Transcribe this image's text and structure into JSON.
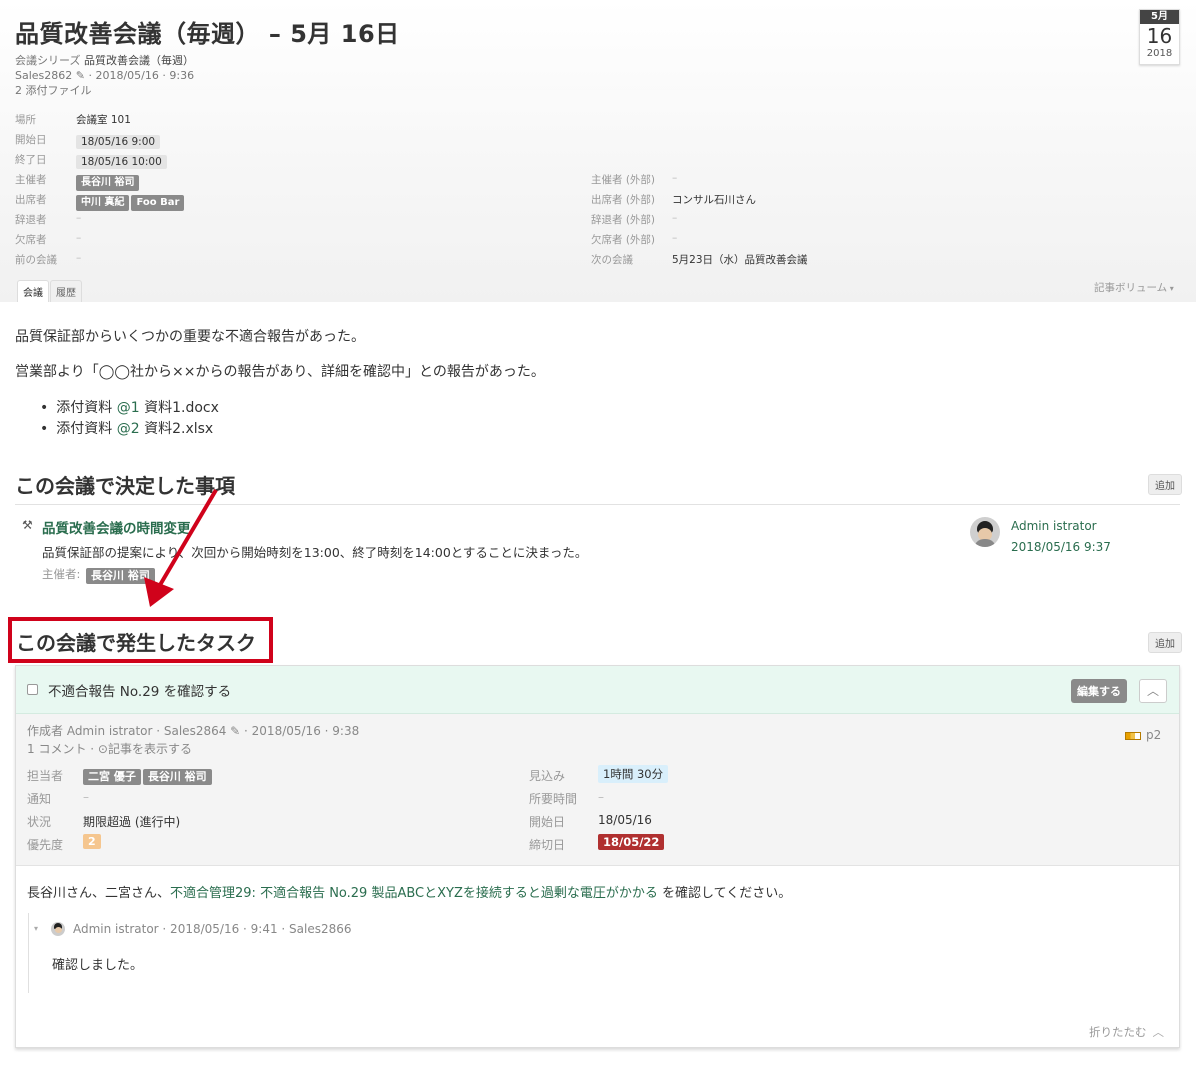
{
  "header": {
    "title": "品質改善会議（毎週） – 5月 16日",
    "series_label": "会議シリーズ",
    "series_name": "品質改善会議（毎週）",
    "record_info": "Sales2862 ✎ · 2018/05/16 · 9:36",
    "attachments": "2 添付ファイル",
    "calendar": {
      "month": "5月",
      "day": "16",
      "year": "2018"
    }
  },
  "fields_left": {
    "location_label": "場所",
    "location_value": "会議室 101",
    "start_label": "開始日",
    "start_value": "18/05/16 9:00",
    "end_label": "終了日",
    "end_value": "18/05/16 10:00",
    "organizer_label": "主催者",
    "organizer_value": "長谷川 裕司",
    "attendees_label": "出席者",
    "attendees": [
      "中川 真紀",
      "Foo Bar"
    ],
    "declined_label": "辞退者",
    "declined_value": "–",
    "absent_label": "欠席者",
    "absent_value": "–",
    "prev_label": "前の会議",
    "prev_value": "–"
  },
  "fields_right": {
    "ext_organizer_label": "主催者 (外部)",
    "ext_organizer_value": "–",
    "ext_attendees_label": "出席者 (外部)",
    "ext_attendees_value": "コンサル石川さん",
    "ext_declined_label": "辞退者 (外部)",
    "ext_declined_value": "–",
    "ext_absent_label": "欠席者 (外部)",
    "ext_absent_value": "–",
    "next_label": "次の会議",
    "next_value": "5月23日（水）品質改善会議"
  },
  "tabs": {
    "meeting": "会議",
    "history": "履歴",
    "volume": "記事ボリューム"
  },
  "content": {
    "para1": "品質保証部からいくつかの重要な不適合報告があった。",
    "para2": "営業部より「◯◯社から××からの報告があり、詳細を確認中」との報告があった。",
    "bullets": [
      {
        "prefix": "添付資料 ",
        "ref": "@1",
        "file": " 資料1.docx"
      },
      {
        "prefix": "添付資料 ",
        "ref": "@2",
        "file": " 資料2.xlsx"
      }
    ]
  },
  "decisions": {
    "heading": "この会議で決定した事項",
    "add": "追加",
    "item_title": "品質改善会議の時間変更",
    "item_body": "品質保証部の提案により、次回から開始時刻を13:00、終了時刻を14:00とすることに決まった。",
    "organizer_label": "主催者:",
    "organizer_tag": "長谷川 裕司",
    "author": "Admin istrator",
    "author_time": "2018/05/16 9:37"
  },
  "tasks": {
    "heading": "この会議で発生したタスク",
    "add": "追加",
    "task_title": "不適合報告 No.29 を確認する",
    "edit": "編集する",
    "creator_line": "作成者 Admin istrator · Sales2864 ✎ · 2018/05/16 · 9:38",
    "comments_line": "1 コメント · ⊙記事を表示する",
    "priority_code": "p2",
    "assignee_label": "担当者",
    "assignees": [
      "二宮 優子",
      "長谷川 裕司"
    ],
    "notify_label": "通知",
    "notify_value": "–",
    "status_label": "状況",
    "status_value": "期限超過 (進行中)",
    "priority_label": "優先度",
    "priority_value": "2",
    "estimate_label": "見込み",
    "estimate_value": "1時間 30分",
    "spent_label": "所要時間",
    "spent_value": "–",
    "start_label": "開始日",
    "start_value": "18/05/16",
    "due_label": "締切日",
    "due_value": "18/05/22",
    "body_prefix": "長谷川さん、二宮さん、",
    "body_link": "不適合管理29: 不適合報告 No.29 製品ABCとXYZを接続すると過剰な電圧がかかる",
    "body_suffix": " を確認してください。",
    "comment_header": "Admin istrator · 2018/05/16 · 9:41 · Sales2866",
    "comment_body": "確認しました。",
    "collapse": "折りたたむ"
  },
  "colors": {
    "accent_green": "#2a6d4e",
    "highlight_red": "#d0021b",
    "due_red": "#b03030"
  }
}
